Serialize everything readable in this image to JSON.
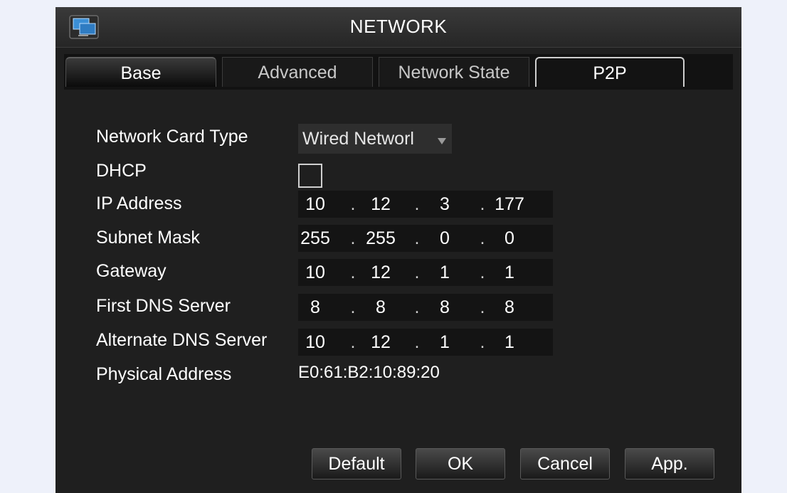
{
  "window": {
    "title": "NETWORK",
    "icon": "network-computer-icon"
  },
  "tabs": [
    {
      "label": "Base",
      "active": true
    },
    {
      "label": "Advanced",
      "active": false
    },
    {
      "label": "Network State",
      "active": false
    },
    {
      "label": "P2P",
      "active": false
    }
  ],
  "form": {
    "network_card_type": {
      "label": "Network Card Type",
      "value": "Wired Networl"
    },
    "dhcp": {
      "label": "DHCP",
      "checked": false
    },
    "ip_address": {
      "label": "IP Address",
      "octets": [
        "10",
        "12",
        "3",
        "177"
      ]
    },
    "subnet_mask": {
      "label": "Subnet Mask",
      "octets": [
        "255",
        "255",
        "0",
        "0"
      ]
    },
    "gateway": {
      "label": "Gateway",
      "octets": [
        "10",
        "12",
        "1",
        "1"
      ]
    },
    "first_dns": {
      "label": "First DNS Server",
      "octets": [
        "8",
        "8",
        "8",
        "8"
      ]
    },
    "alternate_dns": {
      "label": "Alternate DNS Server",
      "octets": [
        "10",
        "12",
        "1",
        "1"
      ]
    },
    "physical_address": {
      "label": "Physical Address",
      "value": "E0:61:B2:10:89:20"
    }
  },
  "separator": ".",
  "buttons": {
    "default": "Default",
    "ok": "OK",
    "cancel": "Cancel",
    "apply": "App."
  }
}
